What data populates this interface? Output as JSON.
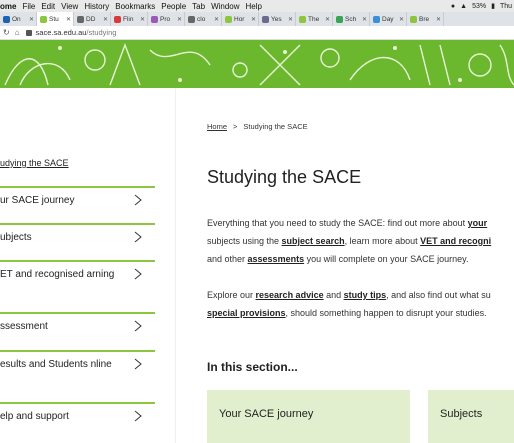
{
  "menubar": {
    "app": "ome",
    "items": [
      "File",
      "Edit",
      "View",
      "History",
      "Bookmarks",
      "People",
      "Tab",
      "Window",
      "Help"
    ],
    "battery": "53%",
    "day": "Thu"
  },
  "tabs": [
    {
      "label": "On",
      "color": "#1b64b3",
      "active": false
    },
    {
      "label": "Stu",
      "color": "#8cc63f",
      "active": true
    },
    {
      "label": "DD",
      "color": "#666666",
      "active": false
    },
    {
      "label": "Flin",
      "color": "#d83b3b",
      "active": false
    },
    {
      "label": "Pro",
      "color": "#9b59b6",
      "active": false
    },
    {
      "label": "clo",
      "color": "#666666",
      "active": false
    },
    {
      "label": "Hor",
      "color": "#8cc63f",
      "active": false
    },
    {
      "label": "Yes",
      "color": "#6a6a8a",
      "active": false
    },
    {
      "label": "The",
      "color": "#8cc63f",
      "active": false
    },
    {
      "label": "Sch",
      "color": "#3aa356",
      "active": false
    },
    {
      "label": "Day",
      "color": "#3a8fd8",
      "active": false
    },
    {
      "label": "Bre",
      "color": "#8cc63f",
      "active": false
    }
  ],
  "address": {
    "domain": "sace.sa.edu.au",
    "path": "/studying"
  },
  "sidebar": {
    "title": "udying the SACE",
    "items": [
      {
        "label": "ur SACE journey"
      },
      {
        "label": "ubjects"
      },
      {
        "label": "ET and recognised arning"
      },
      {
        "label": "ssessment"
      },
      {
        "label": "esults and Students nline"
      },
      {
        "label": "elp and support"
      }
    ]
  },
  "main": {
    "breadcrumb_home": "Home",
    "breadcrumb_sep": ">",
    "breadcrumb_current": "Studying the SACE",
    "title": "Studying the SACE",
    "p1_line1_a": "Everything that you need to study the SACE: find out more about ",
    "p1_line1_link": "your",
    "p1_line2_a": "subjects using the ",
    "p1_line2_link1": "subject search",
    "p1_line2_b": ", learn more about ",
    "p1_line2_link2": "VET and recogni",
    "p1_line3_a": "and other ",
    "p1_line3_link": "assessments",
    "p1_line3_b": " you will complete on your SACE journey.",
    "p2_line1_a": "Explore our ",
    "p2_line1_link1": "research advice",
    "p2_line1_b": " and ",
    "p2_line1_link2": "study tips",
    "p2_line1_c": ", and also find out what su",
    "p2_line2_link": "special provisions",
    "p2_line2_b": ", should something happen to disrupt your studies.",
    "section_head": "In this section...",
    "cards": [
      "Your SACE journey",
      "Subjects"
    ]
  },
  "colors": {
    "brand_green": "#6bb82f",
    "rule_green": "#8cc63f",
    "card_bg": "#e2efcf"
  }
}
